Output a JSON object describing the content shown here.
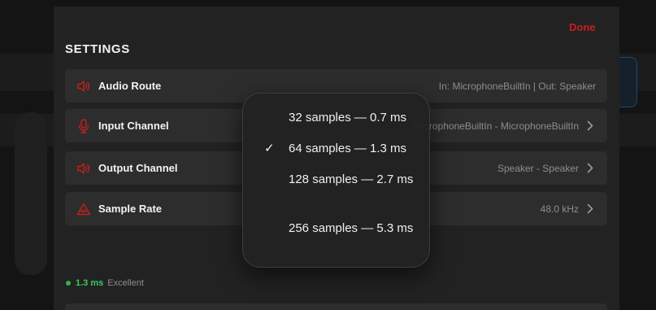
{
  "settings": {
    "title": "SETTINGS",
    "done_label": "Done",
    "rows": [
      {
        "label": "Audio Route",
        "value": "In: MicrophoneBuiltIn | Out: Speaker",
        "icon": "speaker-icon"
      },
      {
        "label": "Input Channel",
        "value": "MicrophoneBuiltIn - MicrophoneBuiltIn",
        "icon": "microphone-icon"
      },
      {
        "label": "Output Channel",
        "value": "Speaker - Speaker",
        "icon": "speaker-icon"
      },
      {
        "label": "Sample Rate",
        "value": "48.0 kHz",
        "icon": "waveform-warning-icon"
      }
    ],
    "latency": {
      "value": "1.3 ms",
      "quality": "Excellent"
    }
  },
  "buffer_menu": {
    "items": [
      {
        "label": "32 samples — 0.7 ms",
        "selected": false
      },
      {
        "label": "64 samples — 1.3 ms",
        "selected": true
      },
      {
        "label": "128 samples — 2.7 ms",
        "selected": false
      },
      {
        "label": "256 samples — 5.3 ms",
        "selected": false
      }
    ],
    "check_glyph": "✓"
  },
  "colors": {
    "accent": "#c61f1f",
    "status_good": "#3fc65e",
    "row_bg": "#2d2d2d",
    "sheet_bg": "#222222"
  }
}
